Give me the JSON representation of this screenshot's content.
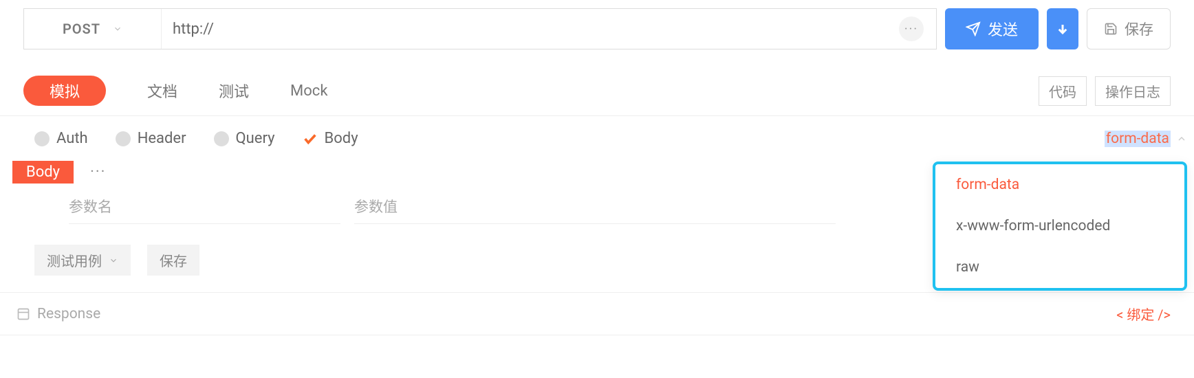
{
  "request": {
    "method": "POST",
    "url": "http://",
    "send_label": "发送",
    "save_label": "保存"
  },
  "tabs": {
    "simulate": "模拟",
    "docs": "文档",
    "test": "测试",
    "mock": "Mock",
    "code": "代码",
    "log": "操作日志"
  },
  "sections": {
    "auth": "Auth",
    "header": "Header",
    "query": "Query",
    "body": "Body"
  },
  "body_format": {
    "current": "form-data",
    "options": [
      "form-data",
      "x-www-form-urlencoded",
      "raw"
    ]
  },
  "body_tag": "Body",
  "params": {
    "name_label": "参数名",
    "value_label": "参数值"
  },
  "actions": {
    "testcase": "测试用例",
    "save": "保存"
  },
  "response": {
    "label": "Response",
    "bind": "< 绑定 />"
  }
}
